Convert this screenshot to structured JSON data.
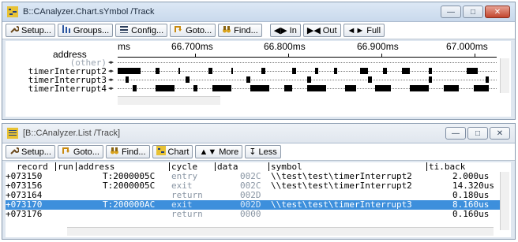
{
  "chart_window": {
    "title": "B::CAnalyzer.Chart.sYmbol /Track",
    "toolbar": [
      {
        "label": "Setup...",
        "icon": "wrench-icon"
      },
      {
        "label": "Groups...",
        "icon": "groups-icon"
      },
      {
        "label": "Config...",
        "icon": "config-icon"
      },
      {
        "label": "Goto...",
        "icon": "goto-icon"
      },
      {
        "label": "Find...",
        "icon": "binoculars-icon"
      },
      {
        "label": "In",
        "icon": "zoom-in-icon"
      },
      {
        "label": "Out",
        "icon": "zoom-out-icon"
      },
      {
        "label": "Full",
        "icon": "zoom-full-icon"
      }
    ],
    "ruler": {
      "unit": "ms",
      "column_header": "address",
      "ticks": [
        "66.700ms",
        "66.800ms",
        "66.900ms",
        "67.000ms"
      ]
    },
    "rows": [
      {
        "label": "(other)",
        "dim": true,
        "segments": []
      },
      {
        "label": "timerInterrupt2",
        "dim": false,
        "segments": [
          [
            0,
            0.06
          ],
          [
            0.1,
            0.11
          ],
          [
            0.16,
            0.165
          ],
          [
            0.24,
            0.25
          ],
          [
            0.3,
            0.305
          ],
          [
            0.38,
            0.39
          ],
          [
            0.46,
            0.47
          ],
          [
            0.52,
            0.53
          ],
          [
            0.57,
            0.58
          ],
          [
            0.64,
            0.66
          ],
          [
            0.7,
            0.71
          ],
          [
            0.75,
            0.77
          ],
          [
            0.82,
            0.83
          ],
          [
            0.92,
            0.95
          ]
        ]
      },
      {
        "label": "timerInterrupt3",
        "dim": false,
        "segments": [
          [
            0.02,
            0.03
          ],
          [
            0.18,
            0.19
          ],
          [
            0.34,
            0.35
          ],
          [
            0.5,
            0.51
          ],
          [
            0.66,
            0.67
          ],
          [
            0.82,
            0.83
          ],
          [
            0.97,
            0.98
          ]
        ]
      },
      {
        "label": "timerInterrupt4",
        "dim": false,
        "segments": [
          [
            0.04,
            0.05
          ],
          [
            0.1,
            0.15
          ],
          [
            0.2,
            0.21
          ],
          [
            0.25,
            0.3
          ],
          [
            0.35,
            0.4
          ],
          [
            0.44,
            0.46
          ],
          [
            0.5,
            0.55
          ],
          [
            0.6,
            0.63
          ],
          [
            0.68,
            0.72
          ],
          [
            0.77,
            0.82
          ],
          [
            0.86,
            0.9
          ],
          [
            0.94,
            0.98
          ]
        ]
      }
    ]
  },
  "list_window": {
    "title": "[B::CAnalyzer.List /Track]",
    "toolbar": [
      {
        "label": "Setup...",
        "icon": "wrench-icon"
      },
      {
        "label": "Goto...",
        "icon": "goto-icon"
      },
      {
        "label": "Find...",
        "icon": "binoculars-icon"
      },
      {
        "label": "Chart",
        "icon": "chart-icon"
      },
      {
        "label": "More",
        "icon": "more-icon"
      },
      {
        "label": "Less",
        "icon": "less-icon"
      }
    ],
    "columns": [
      "record",
      "run",
      "address",
      "cycle",
      "data",
      "symbol",
      "ti.back"
    ],
    "rows": [
      {
        "record": "+073150",
        "address": "T:2000005C",
        "cycle": "entry",
        "data": "002C",
        "symbol": "\\\\test\\test\\timerInterrupt2",
        "tiback": "2.000us",
        "selected": false
      },
      {
        "record": "+073156",
        "address": "T:2000005C",
        "cycle": "exit",
        "data": "002C",
        "symbol": "\\\\test\\test\\timerInterrupt2",
        "tiback": "14.320us",
        "selected": false
      },
      {
        "record": "+073164",
        "address": "",
        "cycle": "return",
        "data": "002D",
        "symbol": "",
        "tiback": "0.180us",
        "selected": false
      },
      {
        "record": "+073170",
        "address": "T:200000AC",
        "cycle": "exit",
        "data": "002D",
        "symbol": "\\\\test\\test\\timerInterrupt3",
        "tiback": "8.160us",
        "selected": true
      },
      {
        "record": "+073176",
        "address": "",
        "cycle": "return",
        "data": "0000",
        "symbol": "",
        "tiback": "0.160us",
        "selected": false
      }
    ]
  },
  "colors": {
    "selection": "#3d8fdc",
    "close_button": "#c2452d"
  }
}
